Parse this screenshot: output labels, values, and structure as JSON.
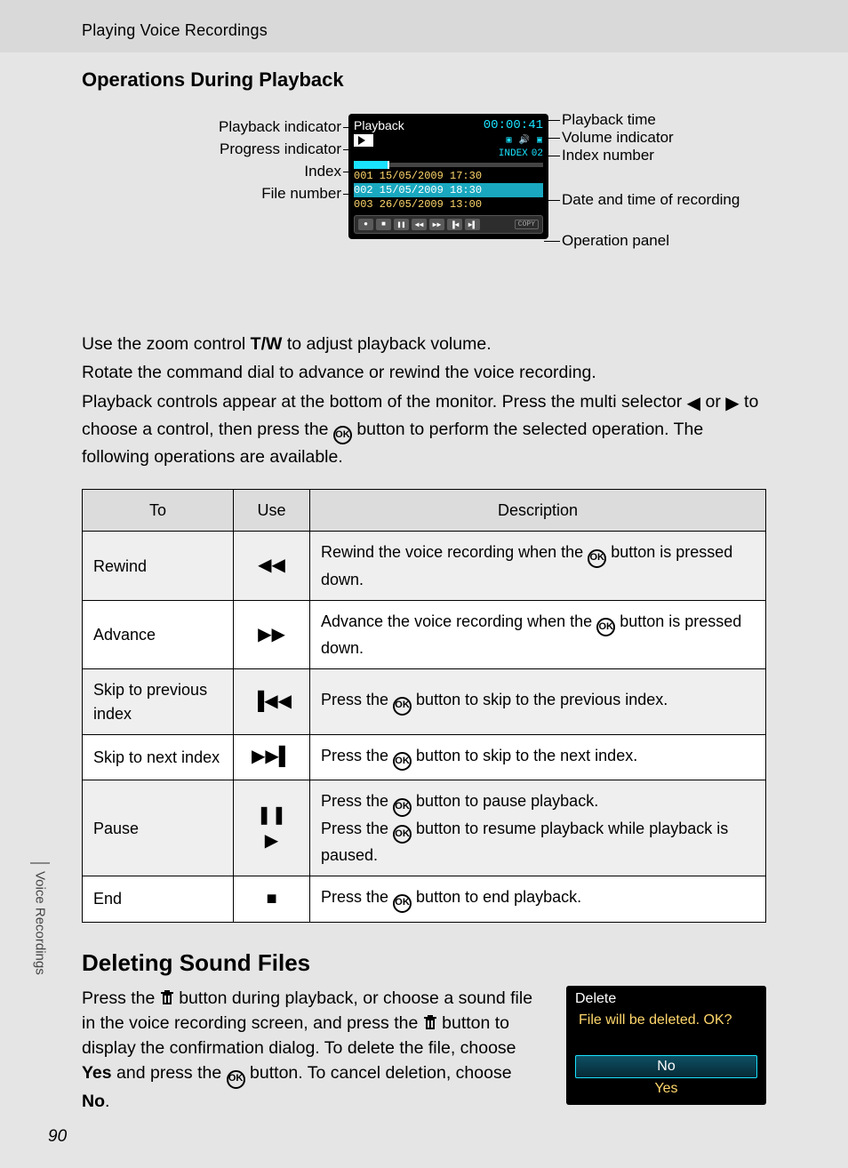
{
  "header": "Playing Voice Recordings",
  "section1_title": "Operations During Playback",
  "diagram": {
    "left": {
      "playback_indicator": "Playback indicator",
      "progress_indicator": "Progress indicator",
      "index": "Index",
      "file_number": "File number"
    },
    "right": {
      "playback_time": "Playback time",
      "volume_indicator": "Volume indicator",
      "index_number": "Index number",
      "date_time": "Date and time of recording",
      "operation_panel": "Operation panel"
    },
    "lcd": {
      "title": "Playback",
      "time": "00:00:41",
      "vol_icons": "▣ 🔊 ▣",
      "index_label": "INDEX",
      "index_val": "02",
      "f1": "001 15/05/2009 17:30",
      "f2": "002 15/05/2009 18:30",
      "f3": "003 26/05/2009 13:00",
      "copy": "COPY"
    }
  },
  "para": {
    "p1a": "Use the zoom control ",
    "p1_tw": "T/W",
    "p1b": " to adjust playback volume.",
    "p2": "Rotate the command dial to advance or rewind the voice recording.",
    "p3a": "Playback controls appear at the bottom of the monitor. Press the multi selector ",
    "p3b": " or ",
    "p3c": " to choose a control, then press the ",
    "p3d": " button to perform the selected operation. The following operations are available."
  },
  "table": {
    "h1": "To",
    "h2": "Use",
    "h3": "Description",
    "rows": [
      {
        "to": "Rewind",
        "use": "◀◀",
        "d1": "Rewind the voice recording when the ",
        "d2": " button is pressed down."
      },
      {
        "to": "Advance",
        "use": "▶▶",
        "d1": "Advance the voice recording when the ",
        "d2": " button is pressed down."
      },
      {
        "to": "Skip to previous index",
        "use": "▐◀◀",
        "d1": "Press the ",
        "d2": " button to skip to the previous index."
      },
      {
        "to": "Skip to next index",
        "use": "▶▶▌",
        "d1": "Press the ",
        "d2": " button to skip to the next index."
      },
      {
        "to": "Pause",
        "use": "❚❚\n▶",
        "d1": "Press the ",
        "d2": " button to pause playback.",
        "d3": "Press the ",
        "d4": " button to resume playback while playback is paused."
      },
      {
        "to": "End",
        "use": "■",
        "d1": "Press the ",
        "d2": " button to end playback."
      }
    ]
  },
  "section2_title": "Deleting Sound Files",
  "delete_para": {
    "p1": "Press the ",
    "p2": " button during playback, or choose a sound file in the voice recording screen, and press the ",
    "p3": " button to display the confirmation dialog. To delete the file, choose ",
    "yes": "Yes",
    "p4": " and press the ",
    "p5": " button. To cancel deletion, choose ",
    "no": "No",
    "p6": "."
  },
  "delete_box": {
    "title": "Delete",
    "msg": "File will be deleted. OK?",
    "no": "No",
    "yes": "Yes"
  },
  "sidetab": "Voice Recordings",
  "pagenum": "90",
  "ok": "OK"
}
